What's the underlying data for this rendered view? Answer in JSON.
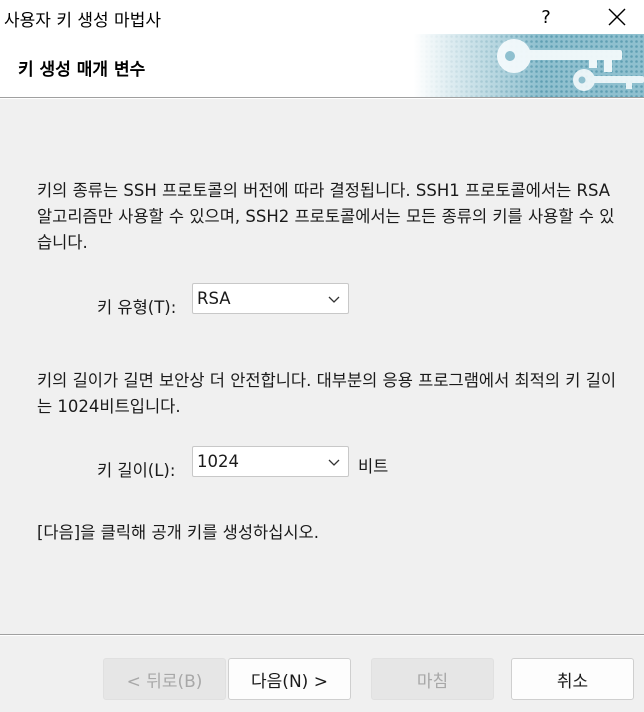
{
  "window": {
    "title": "사용자 키 생성 마법사",
    "help_glyph": "?"
  },
  "header": {
    "title": "키 생성 매개 변수"
  },
  "body": {
    "para_key_type": "키의 종류는 SSH 프로토콜의 버전에 따라 결정됩니다. SSH1 프로토콜에서는 RSA 알고리즘만 사용할 수 있으며, SSH2 프로토콜에서는 모든 종류의 키를 사용할 수 있습니다.",
    "key_type_label": "키 유형(T):",
    "key_type_value": "RSA",
    "para_key_length": "키의 길이가 길면 보안상 더 안전합니다. 대부분의 응용 프로그램에서 최적의 키 길이는 1024비트입니다.",
    "key_length_label": "키 길이(L):",
    "key_length_value": "1024",
    "key_length_unit": "비트",
    "para_next": "[다음]을 클릭해 공개 키를 생성하십시오."
  },
  "footer": {
    "back_label": "< 뒤로(B)",
    "next_label": "다음(N) >",
    "finish_label": "마침",
    "cancel_label": "취소"
  },
  "colors": {
    "background": "#f0f0f0",
    "banner_art": "#7fb5c8",
    "disabled_text": "#a8a8a8"
  }
}
